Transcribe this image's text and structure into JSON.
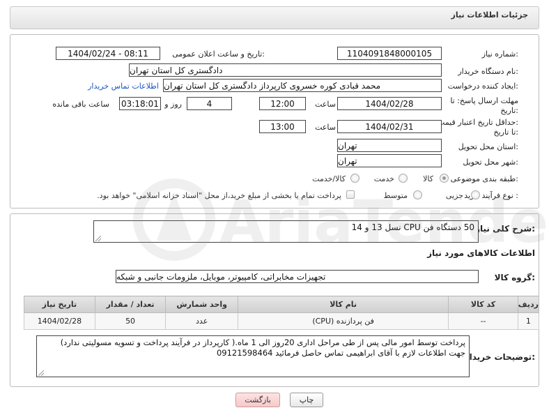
{
  "header": {
    "title": "جزئیات اطلاعات نیاز"
  },
  "form": {
    "need_number_label": "شماره نیاز:",
    "need_number": "1104091848000105",
    "announce_label": "تاریخ و ساعت اعلان عمومی:",
    "announce_value": "1404/02/24 - 08:11",
    "buyer_org_label": "نام دستگاه خریدار:",
    "buyer_org": "دادگستری کل استان تهران",
    "creator_label": "ایجاد کننده درخواست:",
    "creator": "محمد قبادی کوره خسروی کارپرداز دادگستری کل استان تهران",
    "contact_link": "اطلاعات تماس خریدار",
    "deadline_label_1": "مهلت ارسال پاسخ: تا",
    "deadline_label_2": "تاریخ:",
    "deadline_date": "1404/02/28",
    "time_label": "ساعت",
    "deadline_time": "12:00",
    "days_value": "4",
    "days_label": "روز و",
    "remaining_time": "03:18:01",
    "remaining_label": "ساعت باقی مانده",
    "validity_label_1": "حداقل تاریخ اعتبار قیمت:",
    "validity_label_2": "تا تاریخ:",
    "validity_date": "1404/02/31",
    "validity_time": "13:00",
    "province_label": "استان محل تحویل:",
    "province": "تهران",
    "city_label": "شهر محل تحویل:",
    "city": "تهران",
    "category_label": "طبقه بندی موضوعی:",
    "category_options": [
      "کالا",
      "خدمت",
      "کالا/خدمت"
    ],
    "process_label": "نوع فرآیند خرید :",
    "process_options": [
      "جزیی",
      "متوسط"
    ],
    "payment_note": "پرداخت تمام یا بخشی از مبلغ خرید،از محل \"اسناد خزانه اسلامی\" خواهد بود."
  },
  "details": {
    "summary_label": "شرح کلی نیاز:",
    "summary": "50 دستگاه فن CPU نسل 13 و 14",
    "goods_info_title": "اطلاعات کالاهای مورد نیاز",
    "group_label": "گروه کالا:",
    "group_value": "تجهیزات مخابراتی، کامپیوتر، موبایل، ملزومات جانبی و شبکه",
    "table": {
      "headers": [
        "ردیف",
        "کد کالا",
        "نام کالا",
        "واحد شمارش",
        "تعداد / مقدار",
        "تاریخ نیاز"
      ],
      "rows": [
        [
          "1",
          "--",
          "فن پردازنده (CPU)",
          "عدد",
          "50",
          "1404/02/28"
        ]
      ]
    },
    "buyer_notes_label": "توضیحات خریدار:",
    "buyer_notes_line1": "پرداخت توسط امور مالی پس از طی مراحل اداری 20روز الی 1 ماه.( کارپرداز در فرآیند پرداخت و تسویه مسولیتی ندارد)",
    "buyer_notes_line2": "جهت اطلاعات لازم با آقای ابراهیمی تماس حاصل فرمائید 09121598464"
  },
  "buttons": {
    "print": "چاپ",
    "back": "بازگشت"
  },
  "watermark": {
    "text": "AriaTender.net"
  },
  "colors": {
    "link": "#1a56c7",
    "back_button": "#f7c9c9"
  }
}
